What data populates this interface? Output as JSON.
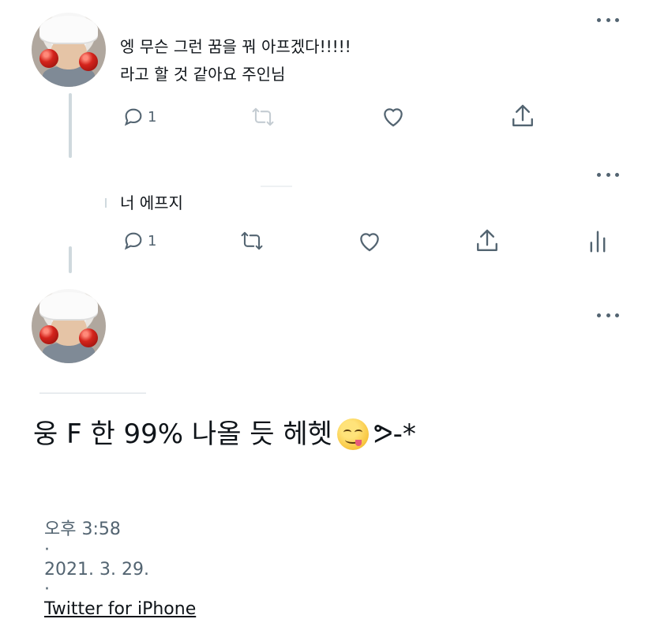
{
  "tweets": [
    {
      "text_line1": "엥 무슨 그런 꿈을 꿔 아프겠다!!!!!",
      "text_line2": "라고 할 것 같아요 주인님",
      "reply_count": "1",
      "icons": [
        "reply-icon",
        "retweet-icon",
        "like-icon",
        "share-icon"
      ]
    },
    {
      "text_line1": "너 에프지",
      "reply_count": "1",
      "icons": [
        "reply-icon",
        "retweet-icon",
        "like-icon",
        "share-icon",
        "analytics-icon"
      ]
    }
  ],
  "main_tweet": {
    "text": "웅 F 한 99% 나올 듯 헤헷",
    "text_suffix": "ᕗ-*",
    "emoji": "savoring-food-face-emoji",
    "time": "오후 3:58",
    "date": "2021. 3. 29.",
    "separator": "·",
    "source": "Twitter for iPhone"
  },
  "colors": {
    "text": "#0f1419",
    "muted": "#536471",
    "thread_line": "#cfd9de"
  }
}
